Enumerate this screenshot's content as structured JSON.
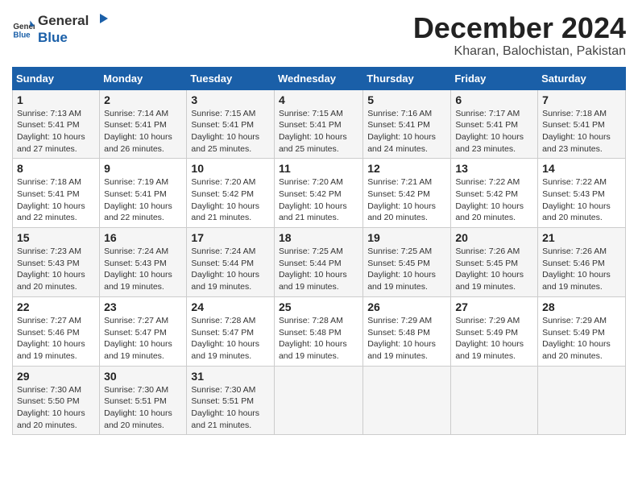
{
  "logo": {
    "general": "General",
    "blue": "Blue"
  },
  "header": {
    "month": "December 2024",
    "location": "Kharan, Balochistan, Pakistan"
  },
  "weekdays": [
    "Sunday",
    "Monday",
    "Tuesday",
    "Wednesday",
    "Thursday",
    "Friday",
    "Saturday"
  ],
  "weeks": [
    [
      {
        "day": "1",
        "sunrise": "7:13 AM",
        "sunset": "5:41 PM",
        "daylight": "10 hours and 27 minutes."
      },
      {
        "day": "2",
        "sunrise": "7:14 AM",
        "sunset": "5:41 PM",
        "daylight": "10 hours and 26 minutes."
      },
      {
        "day": "3",
        "sunrise": "7:15 AM",
        "sunset": "5:41 PM",
        "daylight": "10 hours and 25 minutes."
      },
      {
        "day": "4",
        "sunrise": "7:15 AM",
        "sunset": "5:41 PM",
        "daylight": "10 hours and 25 minutes."
      },
      {
        "day": "5",
        "sunrise": "7:16 AM",
        "sunset": "5:41 PM",
        "daylight": "10 hours and 24 minutes."
      },
      {
        "day": "6",
        "sunrise": "7:17 AM",
        "sunset": "5:41 PM",
        "daylight": "10 hours and 23 minutes."
      },
      {
        "day": "7",
        "sunrise": "7:18 AM",
        "sunset": "5:41 PM",
        "daylight": "10 hours and 23 minutes."
      }
    ],
    [
      {
        "day": "8",
        "sunrise": "7:18 AM",
        "sunset": "5:41 PM",
        "daylight": "10 hours and 22 minutes."
      },
      {
        "day": "9",
        "sunrise": "7:19 AM",
        "sunset": "5:41 PM",
        "daylight": "10 hours and 22 minutes."
      },
      {
        "day": "10",
        "sunrise": "7:20 AM",
        "sunset": "5:42 PM",
        "daylight": "10 hours and 21 minutes."
      },
      {
        "day": "11",
        "sunrise": "7:20 AM",
        "sunset": "5:42 PM",
        "daylight": "10 hours and 21 minutes."
      },
      {
        "day": "12",
        "sunrise": "7:21 AM",
        "sunset": "5:42 PM",
        "daylight": "10 hours and 20 minutes."
      },
      {
        "day": "13",
        "sunrise": "7:22 AM",
        "sunset": "5:42 PM",
        "daylight": "10 hours and 20 minutes."
      },
      {
        "day": "14",
        "sunrise": "7:22 AM",
        "sunset": "5:43 PM",
        "daylight": "10 hours and 20 minutes."
      }
    ],
    [
      {
        "day": "15",
        "sunrise": "7:23 AM",
        "sunset": "5:43 PM",
        "daylight": "10 hours and 20 minutes."
      },
      {
        "day": "16",
        "sunrise": "7:24 AM",
        "sunset": "5:43 PM",
        "daylight": "10 hours and 19 minutes."
      },
      {
        "day": "17",
        "sunrise": "7:24 AM",
        "sunset": "5:44 PM",
        "daylight": "10 hours and 19 minutes."
      },
      {
        "day": "18",
        "sunrise": "7:25 AM",
        "sunset": "5:44 PM",
        "daylight": "10 hours and 19 minutes."
      },
      {
        "day": "19",
        "sunrise": "7:25 AM",
        "sunset": "5:45 PM",
        "daylight": "10 hours and 19 minutes."
      },
      {
        "day": "20",
        "sunrise": "7:26 AM",
        "sunset": "5:45 PM",
        "daylight": "10 hours and 19 minutes."
      },
      {
        "day": "21",
        "sunrise": "7:26 AM",
        "sunset": "5:46 PM",
        "daylight": "10 hours and 19 minutes."
      }
    ],
    [
      {
        "day": "22",
        "sunrise": "7:27 AM",
        "sunset": "5:46 PM",
        "daylight": "10 hours and 19 minutes."
      },
      {
        "day": "23",
        "sunrise": "7:27 AM",
        "sunset": "5:47 PM",
        "daylight": "10 hours and 19 minutes."
      },
      {
        "day": "24",
        "sunrise": "7:28 AM",
        "sunset": "5:47 PM",
        "daylight": "10 hours and 19 minutes."
      },
      {
        "day": "25",
        "sunrise": "7:28 AM",
        "sunset": "5:48 PM",
        "daylight": "10 hours and 19 minutes."
      },
      {
        "day": "26",
        "sunrise": "7:29 AM",
        "sunset": "5:48 PM",
        "daylight": "10 hours and 19 minutes."
      },
      {
        "day": "27",
        "sunrise": "7:29 AM",
        "sunset": "5:49 PM",
        "daylight": "10 hours and 19 minutes."
      },
      {
        "day": "28",
        "sunrise": "7:29 AM",
        "sunset": "5:49 PM",
        "daylight": "10 hours and 20 minutes."
      }
    ],
    [
      {
        "day": "29",
        "sunrise": "7:30 AM",
        "sunset": "5:50 PM",
        "daylight": "10 hours and 20 minutes."
      },
      {
        "day": "30",
        "sunrise": "7:30 AM",
        "sunset": "5:51 PM",
        "daylight": "10 hours and 20 minutes."
      },
      {
        "day": "31",
        "sunrise": "7:30 AM",
        "sunset": "5:51 PM",
        "daylight": "10 hours and 21 minutes."
      },
      null,
      null,
      null,
      null
    ]
  ],
  "labels": {
    "sunrise": "Sunrise:",
    "sunset": "Sunset:",
    "daylight": "Daylight:"
  }
}
